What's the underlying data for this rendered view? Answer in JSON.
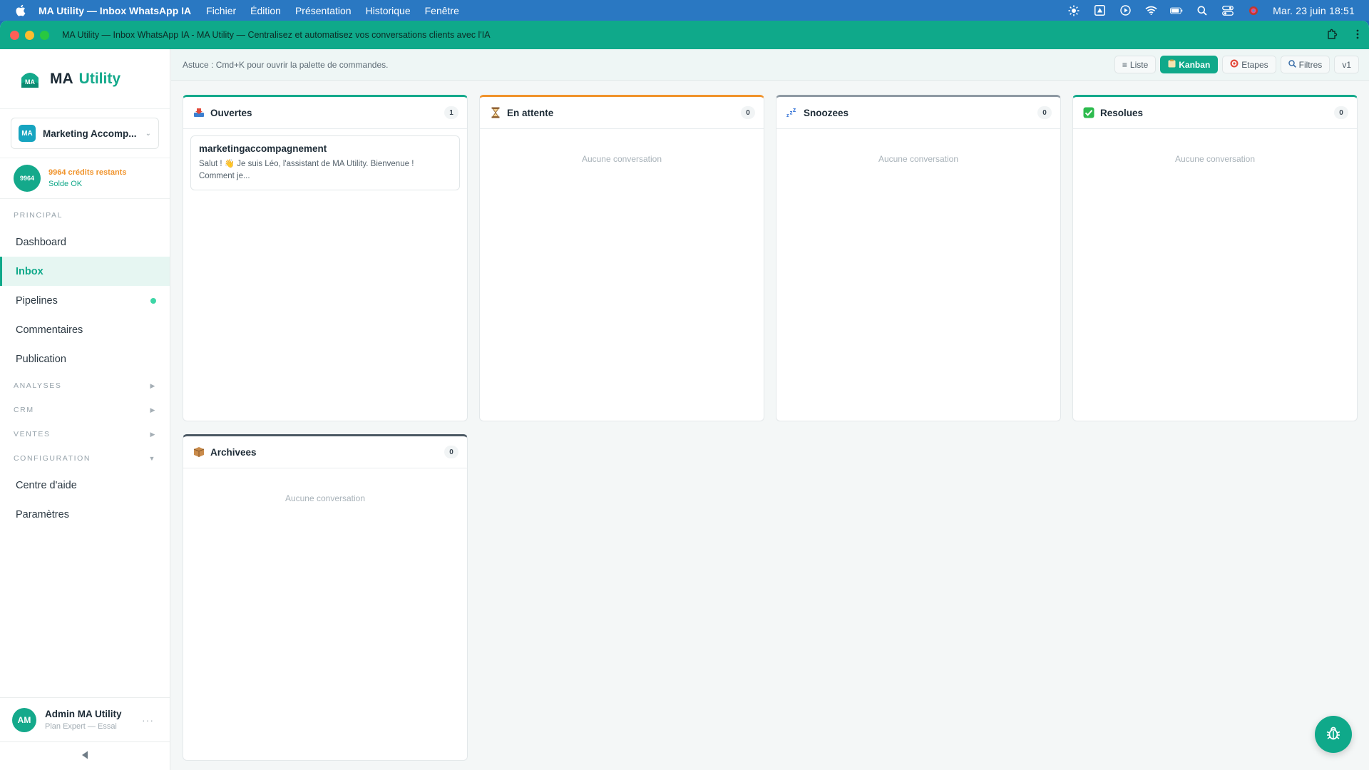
{
  "menubar": {
    "app_name": "MA Utility — Inbox WhatsApp IA",
    "menus": [
      "Fichier",
      "Édition",
      "Présentation",
      "Historique",
      "Fenêtre"
    ],
    "clock": "Mar. 23 juin  18:51"
  },
  "window": {
    "title": "MA Utility — Inbox WhatsApp IA - MA Utility — Centralisez et automatisez vos conversations clients avec l'IA"
  },
  "sidebar": {
    "brand_1": "MA",
    "brand_2": "Utility",
    "workspace": {
      "avatar": "MA",
      "name": "Marketing Accomp..."
    },
    "credits": {
      "badge": "9964",
      "text": "9964 crédits restants",
      "status": "Solde OK"
    },
    "sections": {
      "principal": "PRINCIPAL",
      "analyses": "ANALYSES",
      "crm": "CRM",
      "ventes": "VENTES",
      "configuration": "CONFIGURATION"
    },
    "items": {
      "dashboard": "Dashboard",
      "inbox": "Inbox",
      "pipelines": "Pipelines",
      "commentaires": "Commentaires",
      "publication": "Publication",
      "aide": "Centre d'aide",
      "parametres": "Paramètres"
    },
    "user": {
      "initials": "AM",
      "name": "Admin MA Utility",
      "plan": "Plan Expert — Essai"
    }
  },
  "topbar": {
    "tip": "Astuce : Cmd+K pour ouvrir la palette de commandes.",
    "views": {
      "liste": "Liste",
      "kanban": "Kanban",
      "etapes": "Etapes",
      "filtres": "Filtres",
      "version": "v1"
    }
  },
  "columns": [
    {
      "title": "Ouvertes",
      "count": "1",
      "accent": "#14a98b",
      "icon": "inbox-tray-icon"
    },
    {
      "title": "En attente",
      "count": "0",
      "accent": "#f0932b",
      "icon": "hourglass-icon",
      "empty": "Aucune conversation"
    },
    {
      "title": "Snoozees",
      "count": "0",
      "accent": "#8e99a3",
      "icon": "zzz-icon",
      "empty": "Aucune conversation"
    },
    {
      "title": "Resolues",
      "count": "0",
      "accent": "#14a98b",
      "icon": "check-mark-icon",
      "empty": "Aucune conversation"
    },
    {
      "title": "Archivees",
      "count": "0",
      "accent": "#4b5863",
      "icon": "package-icon",
      "empty": "Aucune conversation"
    }
  ],
  "card": {
    "title": "marketingaccompagnement",
    "message": "Salut ! 👋 Je suis Léo, l'assistant de MA Utility. Bienvenue ! Comment je..."
  }
}
